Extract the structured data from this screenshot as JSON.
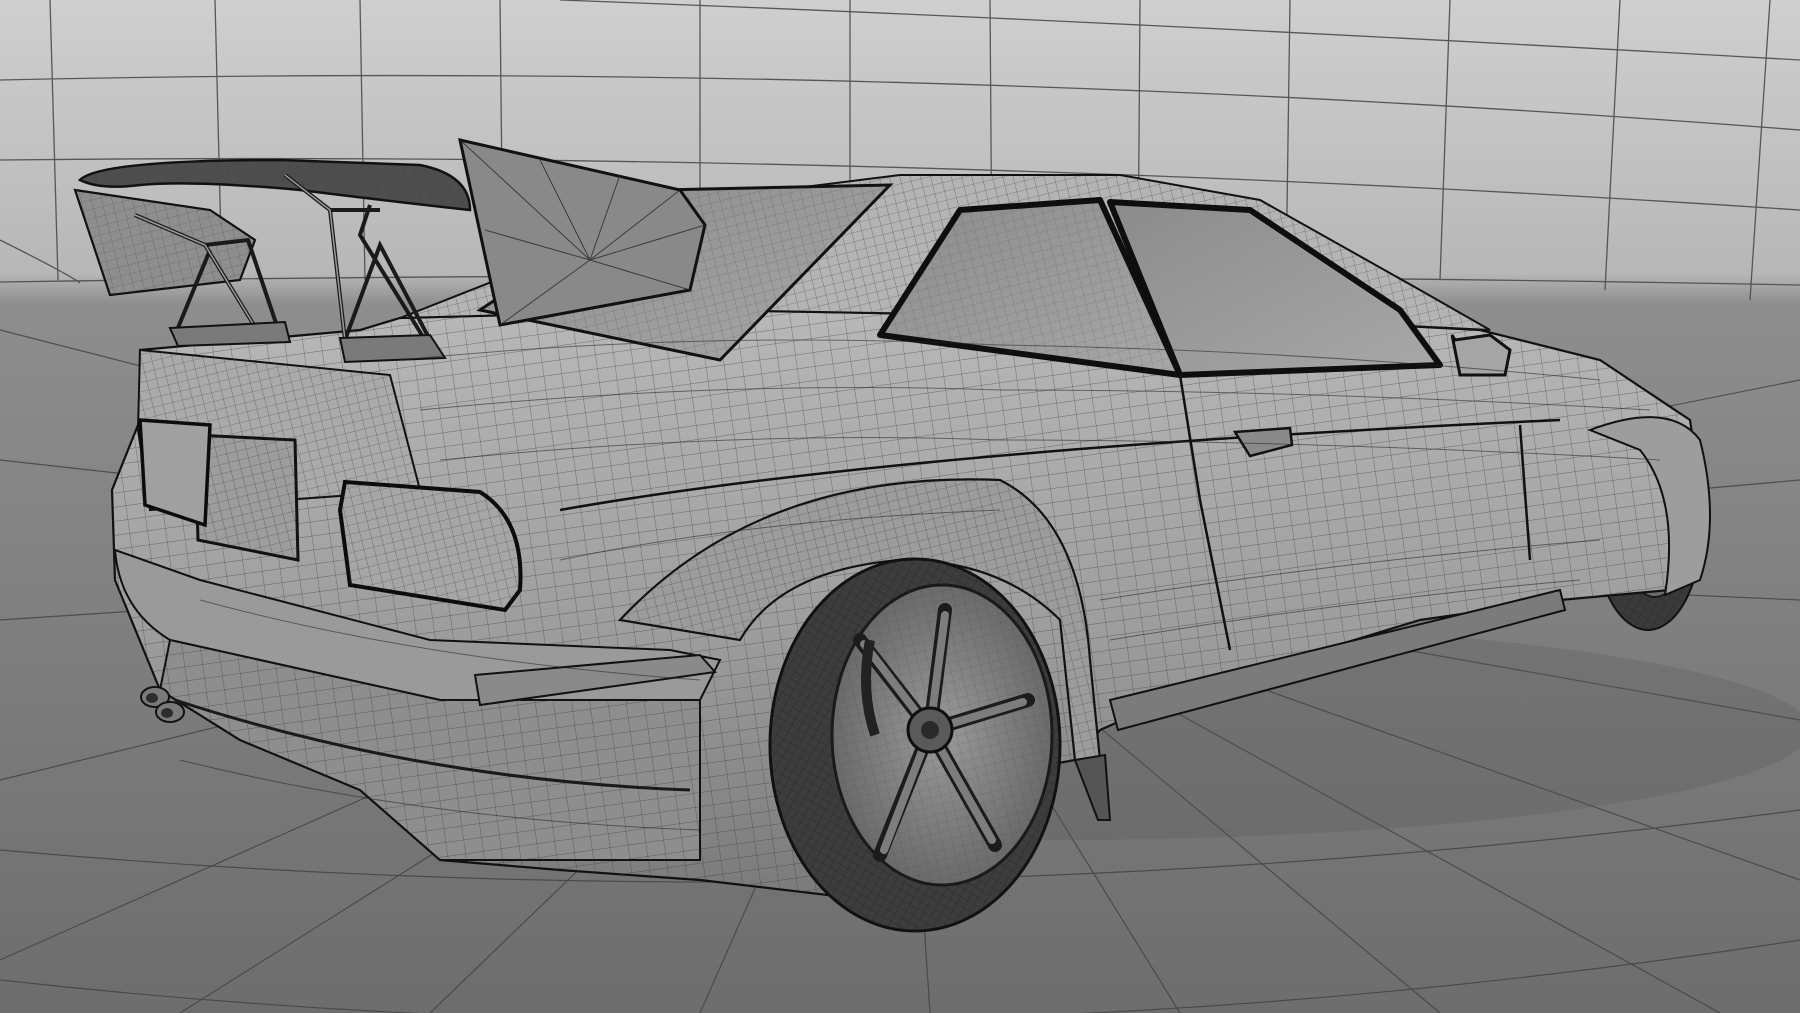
{
  "scene": {
    "subject": "wireframe-car-render",
    "colors": {
      "background_far": "#c4c4c4",
      "background_near": "#7c7c7c",
      "floor": "#8f8f8f",
      "grid_line": "#4a4a4a",
      "body_fill": "#a9a9a9",
      "body_shadow": "#767676",
      "mesh_line": "#2e2e2e",
      "outline": "#1a1a1a",
      "glass": "#9a9a9a",
      "tire": "#3c3c3c",
      "rim": "#8c8c8c",
      "wing": "#5a5a5a"
    }
  }
}
